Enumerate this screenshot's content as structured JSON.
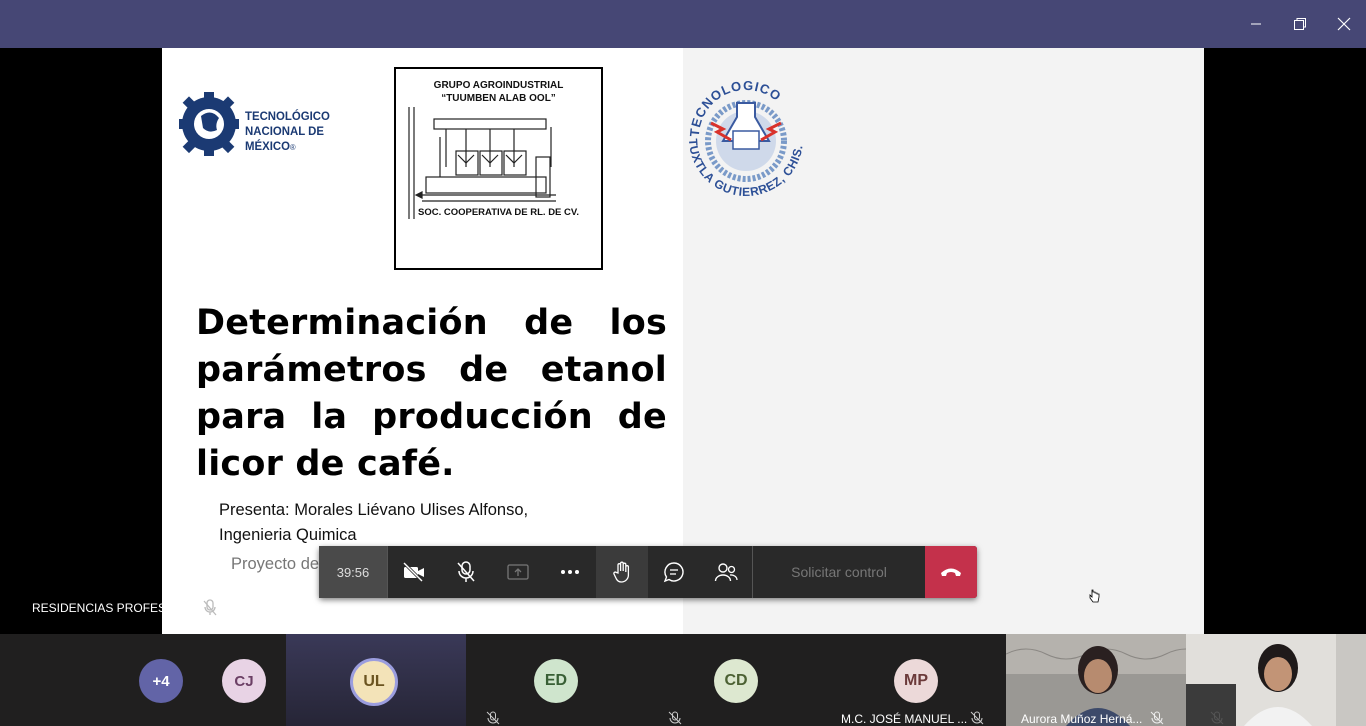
{
  "window": {
    "minimize_icon": "minimize-icon",
    "restore_icon": "restore-icon",
    "close_icon": "close-icon"
  },
  "slide": {
    "tecnm_name_line1": "TECNOLÓGICO",
    "tecnm_name_line2": "NACIONAL DE MÉXICO",
    "tecnm_registered": "®",
    "company_line1": "GRUPO AGROINDUSTRIAL",
    "company_line2": "“TUUMBEN ALAB OOL”",
    "company_footer": "SOC. COOPERATIVA DE RL. DE CV.",
    "ittg_top": "TECNOLOGICO",
    "ittg_bottom": "TUXTLA GUTIERREZ, CHIS.",
    "title": "Determinación de los parámetros de etanol para la producción de licor de café.",
    "presenter_line1": "Presenta: Morales Liévano Ulises Alfonso,",
    "presenter_line2": "Ingenieria Quimica",
    "project": "Proyecto de Residencia Profesional"
  },
  "sharing": {
    "label": "RESIDENCIAS PROFESIONALES"
  },
  "controls": {
    "timer": "39:56",
    "request_control": "Solicitar control"
  },
  "gallery": {
    "overflow_count": "+4",
    "participants": [
      {
        "initials": "CJ"
      },
      {
        "initials": "UL"
      },
      {
        "initials": "ED"
      },
      {
        "initials": "CD"
      },
      {
        "initials": "MP",
        "name": "M.C. JOSÉ MANUEL ..."
      },
      {
        "name": "Aurora Muñoz Herná..."
      },
      {
        "name": ""
      }
    ]
  },
  "colors": {
    "titlebar": "#464775",
    "hangup": "#c4314b",
    "toolbar": "#292929"
  }
}
